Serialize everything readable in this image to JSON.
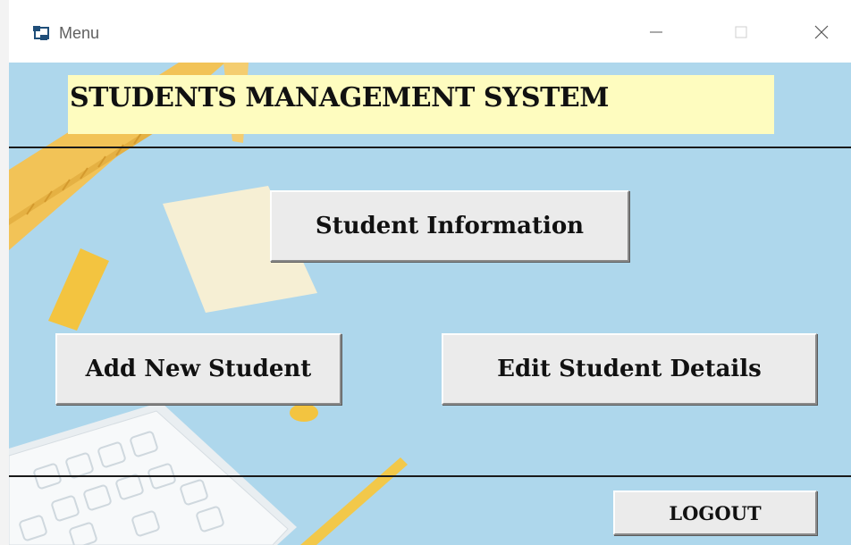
{
  "window": {
    "title": "Menu",
    "icon": "window-app-icon",
    "controls": {
      "minimize_icon": "minimize-icon",
      "maximize_icon": "maximize-icon",
      "close_icon": "close-icon"
    }
  },
  "header": {
    "title": "STUDENTS MANAGEMENT SYSTEM"
  },
  "menu": {
    "student_information": "Student Information",
    "add_new_student": "Add New Student",
    "edit_student_details": "Edit Student Details"
  },
  "footer": {
    "logout": "LOGOUT"
  },
  "colors": {
    "background": "#aed7ec",
    "banner": "#fefcbf",
    "button_face": "#ebebeb"
  }
}
